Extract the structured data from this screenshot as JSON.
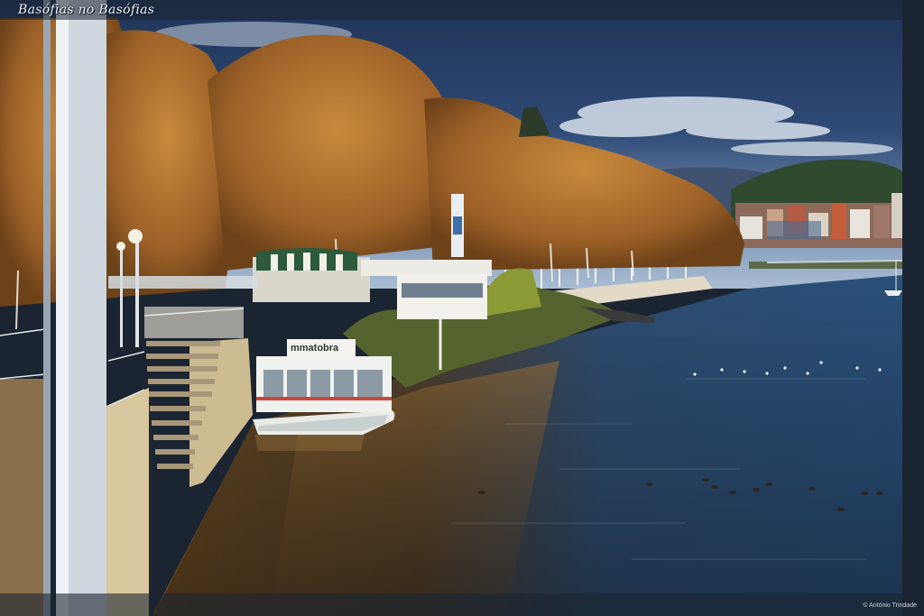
{
  "watermark": {
    "title": "Basófias no Basófias",
    "credit": "© António Trindade"
  },
  "boat": {
    "sign_text": "mmatobra"
  },
  "palette": {
    "frame": "#1b2431",
    "sky_deep": "#23385e",
    "sky_light": "#8ea7c4",
    "foliage": "#b8772f",
    "foliage_dark": "#7a4a1f",
    "water_blue": "#2b4f78",
    "water_gold": "#7a5a2a",
    "stone": "#c9b48a",
    "boat_white": "#eef0ee"
  }
}
